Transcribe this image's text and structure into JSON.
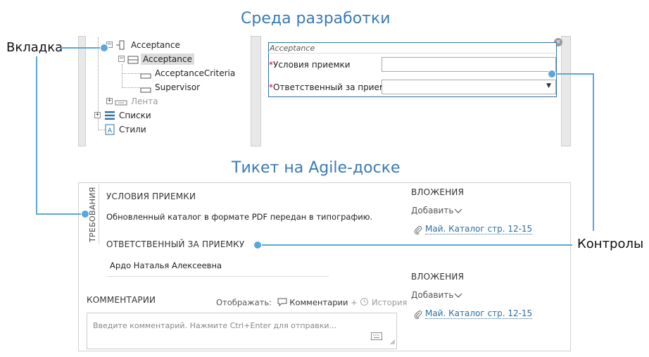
{
  "titles": {
    "dev_env": "Среда разработки",
    "agile_ticket": "Тикет на Agile-доске"
  },
  "callouts": {
    "tab": "Вкладка",
    "controls": "Контролы"
  },
  "dev_env": {
    "tree": [
      {
        "label": "Acceptance",
        "icon": "form-icon",
        "expander": "−",
        "muted": false,
        "selected": false
      },
      {
        "label": "Acceptance",
        "icon": "table-icon",
        "expander": "−",
        "muted": false,
        "selected": true
      },
      {
        "label": "AcceptanceCriteria",
        "icon": "field-icon",
        "expander": "",
        "muted": false,
        "selected": false
      },
      {
        "label": "Supervisor",
        "icon": "field-icon",
        "expander": "",
        "muted": false,
        "selected": false
      },
      {
        "label": "Лента",
        "icon": "ribbon-icon",
        "expander": "+",
        "muted": true,
        "selected": false
      },
      {
        "label": "Списки",
        "icon": "list-icon",
        "expander": "+",
        "muted": false,
        "selected": false
      },
      {
        "label": "Стили",
        "icon": "style-icon",
        "expander": "",
        "muted": false,
        "selected": false
      }
    ],
    "form": {
      "caption": "Acceptance",
      "required_mark": "*",
      "field1_label": "Условия приемки",
      "field1_value": "",
      "field2_label": "Ответственный за приемку",
      "field2_value": "",
      "dropdown_arrow": "▼",
      "close_glyph": "×"
    }
  },
  "ticket": {
    "tab_label": "ТРЕБОВАНИЯ",
    "acceptance_conditions_header": "УСЛОВИЯ ПРИЕМКИ",
    "acceptance_conditions_value": "Обновленный каталог в формате PDF передан в типографию.",
    "responsible_header": "ОТВЕТСТВЕННЫЙ ЗА ПРИЕМКУ",
    "responsible_value": "Ардо Наталья Алексеевна",
    "attachments": [
      {
        "header": "ВЛОЖЕНИЯ",
        "add_label": "Добавить",
        "file": "Май. Каталог стр. 12-15"
      },
      {
        "header": "ВЛОЖЕНИЯ",
        "add_label": "Добавить",
        "file": "Май. Каталог стр. 12-15"
      }
    ],
    "comments": {
      "header": "КОММЕНТАРИИ",
      "display_label": "Отображать:",
      "comments_option": "Комментарии",
      "plus": "+",
      "history_option": "История",
      "placeholder": "Введите комментарий. Нажмите Ctrl+Enter для отправки..."
    }
  },
  "colors": {
    "accent": "#3a7ab5",
    "connector": "#5aa6dd",
    "link": "#2f6f9f",
    "required": "#dd0000"
  }
}
